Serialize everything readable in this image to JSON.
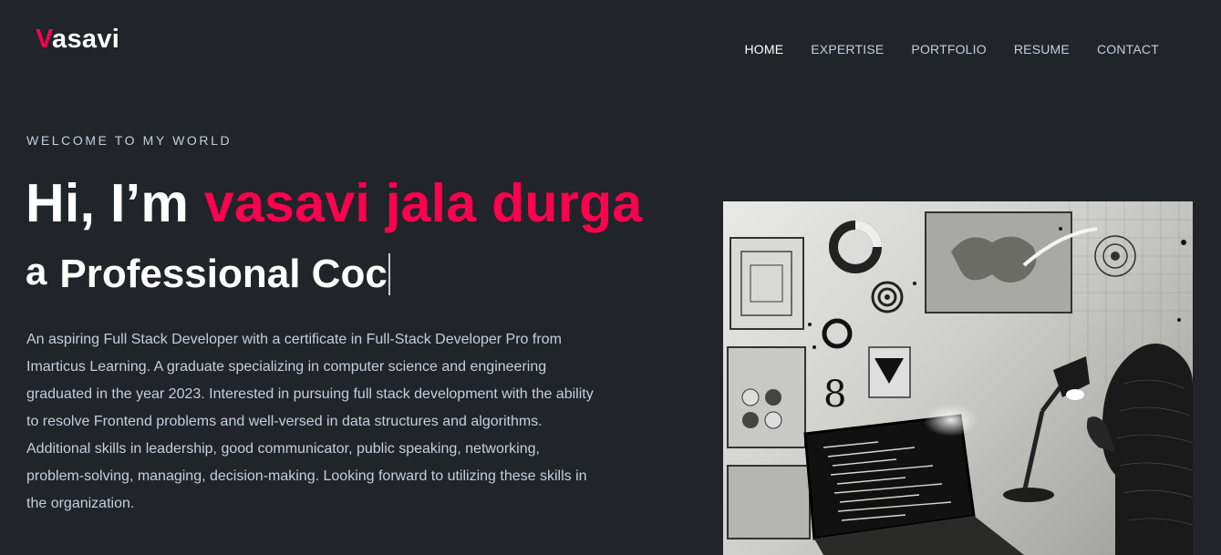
{
  "header": {
    "logo_first": "V",
    "logo_rest": "asavi",
    "nav": [
      {
        "label": "HOME",
        "active": true
      },
      {
        "label": "EXPERTISE"
      },
      {
        "label": "PORTFOLIO"
      },
      {
        "label": "RESUME"
      },
      {
        "label": "CONTACT"
      }
    ]
  },
  "hero": {
    "welcome": "WELCOME TO MY WORLD",
    "greeting": "Hi, I’m ",
    "name": "vasavi jala durga",
    "article": "a",
    "role_typed": "Professional Coc",
    "bio": "An aspiring Full Stack Developer with a certificate in Full-Stack Developer Pro from Imarticus Learning. A graduate specializing in computer science and engineering graduated in the year 2023. Interested in pursuing full stack development with the ability to resolve Frontend problems and well-versed in data structures and algorithms. Additional skills in leadership, good communicator, public speaking, networking, problem-solving, managing, decision-making. Looking forward to utilizing these skills in the organization."
  },
  "colors": {
    "background": "#212428",
    "accent": "#ff014f",
    "text": "#c4cfde",
    "heading": "#ffffff"
  },
  "image": {
    "subject": "monochrome illustration of a person viewing a laptop with code, desk lamp and data visualization panels"
  }
}
